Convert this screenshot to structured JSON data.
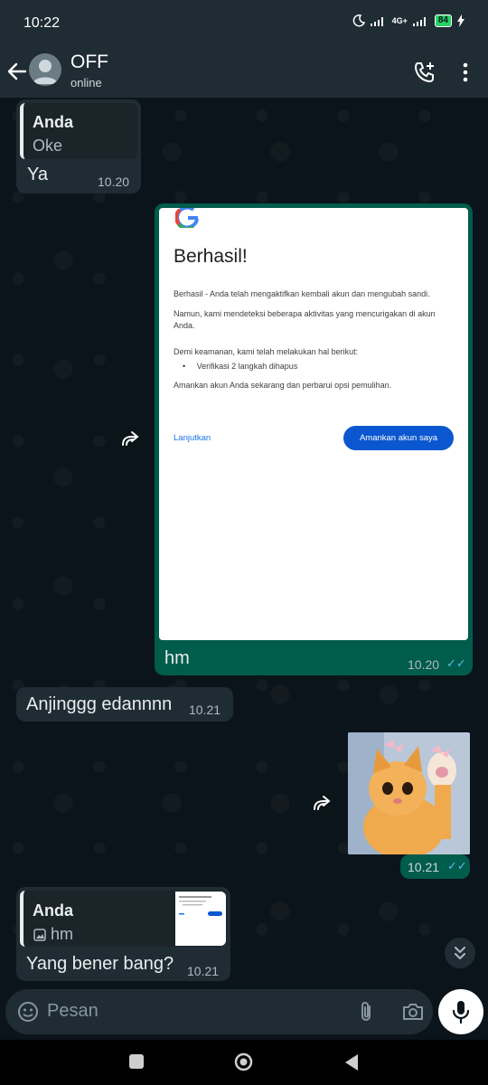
{
  "status_bar": {
    "time": "10:22",
    "network": "4G+",
    "battery": "84"
  },
  "header": {
    "contact_name": "OFF",
    "contact_status": "online"
  },
  "messages": {
    "m1": {
      "quote_author": "Anda",
      "quote_text": "Oke",
      "text": "Ya",
      "time": "10.20"
    },
    "m2": {
      "screenshot": {
        "title": "Berhasil!",
        "p1": "Berhasil - Anda telah mengaktifkan kembali akun dan mengubah sandi.",
        "p2": "Namun, kami mendeteksi beberapa aktivitas yang mencurigakan di akun Anda.",
        "p3": "Demi keamanan, kami telah melakukan hal berikut:",
        "bullet": "Verifikasi 2 langkah dihapus",
        "p4": "Amankan akun Anda sekarang dan perbarui opsi pemulihan.",
        "link": "Lanjutkan",
        "button": "Amankan akun saya"
      },
      "caption": "hm",
      "time": "10.20"
    },
    "m3": {
      "text": "Anjinggg edannnn",
      "time": "10.21"
    },
    "m4": {
      "time": "10.21"
    },
    "m5": {
      "quote_author": "Anda",
      "quote_text": "hm",
      "text": "Yang bener bang?",
      "time": "10.21"
    }
  },
  "composer": {
    "placeholder": "Pesan"
  },
  "icons": {
    "back": "arrow-left-icon",
    "call": "add-call-icon",
    "menu": "more-vert-icon",
    "forward": "forward-icon",
    "emoji": "sticker-icon",
    "attach": "paperclip-icon",
    "camera": "camera-icon",
    "mic": "mic-icon",
    "scroll": "double-chevron-down-icon"
  },
  "colors": {
    "incoming": "#202c33",
    "outgoing": "#005c4b",
    "ticks": "#53bdeb",
    "accent": "#0b57d0"
  }
}
